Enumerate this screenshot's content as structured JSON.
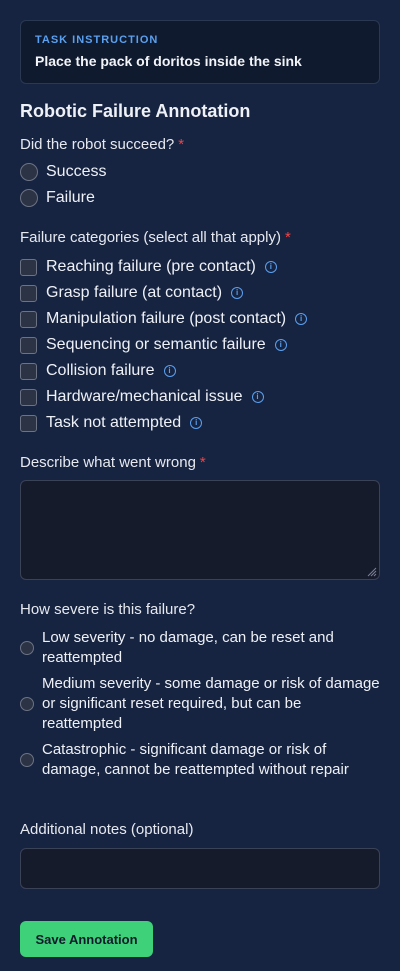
{
  "task": {
    "label": "TASK INSTRUCTION",
    "text": "Place the pack of doritos inside the sink"
  },
  "title": "Robotic Failure Annotation",
  "success_question": {
    "label": "Did the robot succeed?",
    "required_mark": "*",
    "options": [
      "Success",
      "Failure"
    ]
  },
  "categories": {
    "label": "Failure categories (select all that apply)",
    "required_mark": "*",
    "items": [
      "Reaching failure (pre contact)",
      "Grasp failure (at contact)",
      "Manipulation failure (post contact)",
      "Sequencing or semantic failure",
      "Collision failure",
      "Hardware/mechanical issue",
      "Task not attempted"
    ],
    "info_glyph": "i"
  },
  "description": {
    "label": "Describe what went wrong",
    "required_mark": "*",
    "value": ""
  },
  "severity": {
    "label": "How severe is this failure?",
    "options": [
      "Low severity - no damage, can be reset and reattempted",
      "Medium severity - some damage or risk of damage or significant reset required, but can be reattempted",
      "Catastrophic - significant damage or risk of damage, cannot be reattempted without repair"
    ]
  },
  "notes": {
    "label": "Additional notes (optional)",
    "value": ""
  },
  "save_label": "Save Annotation",
  "colors": {
    "background": "#172441",
    "accent": "#5aa0f0",
    "required": "#ef4444",
    "save_button": "#3fd07a"
  }
}
